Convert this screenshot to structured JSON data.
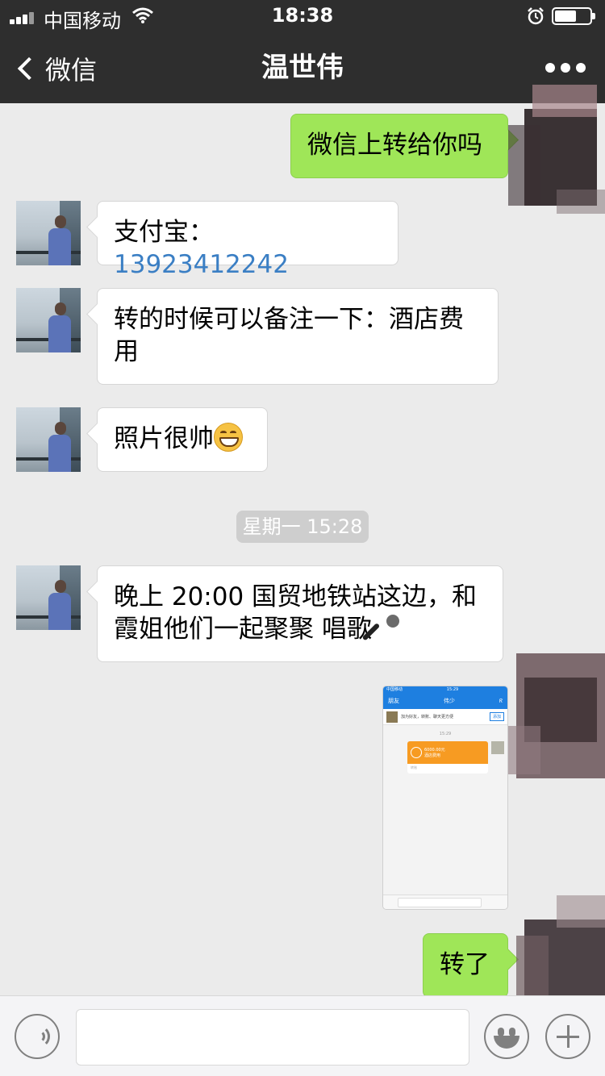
{
  "status_bar": {
    "carrier": "中国移动",
    "time": "18:38",
    "icons": [
      "signal-icon",
      "wifi-icon",
      "alarm-icon",
      "battery-icon"
    ]
  },
  "nav": {
    "back_label": "微信",
    "title": "温世伟",
    "more_icon": "more-dots-icon"
  },
  "messages": [
    {
      "side": "right",
      "text": "微信上转给你吗"
    },
    {
      "side": "left",
      "label": "支付宝：",
      "phone": "13923412242"
    },
    {
      "side": "left",
      "text": "转的时候可以备注一下：酒店费用"
    },
    {
      "side": "left",
      "text": "照片很帅",
      "emoji": "grinning-face-emoji"
    },
    {
      "side": "left",
      "text": "晚上 20:00 国贸地铁站这边，和霞姐他们一起聚聚 唱歌",
      "emoji": "microphone-emoji"
    },
    {
      "side": "right",
      "type": "image",
      "description_icons": [
        "chat-screenshot"
      ]
    },
    {
      "side": "right",
      "text": "转了"
    }
  ],
  "timestamp_divider": "星期一 15:28",
  "screenshot": {
    "carrier": "中国移动",
    "time": "15:29",
    "back": "朋友",
    "title": "伟少",
    "tip": "加为好友，转账、聊天更方便",
    "add": "添加",
    "divider": "15:29",
    "amount": "6000.00元",
    "note": "酒店费用",
    "footer": "转账"
  },
  "input_bar": {
    "voice_icon": "voice-icon",
    "text_value": "",
    "emoji_icon": "emoji-icon",
    "plus_icon": "plus-icon"
  },
  "colors": {
    "nav_bg": "#2e2e2e",
    "chat_bg": "#ebebeb",
    "sent_bubble": "#9fe658",
    "received_bubble": "#ffffff",
    "link": "#3b7fc4"
  }
}
